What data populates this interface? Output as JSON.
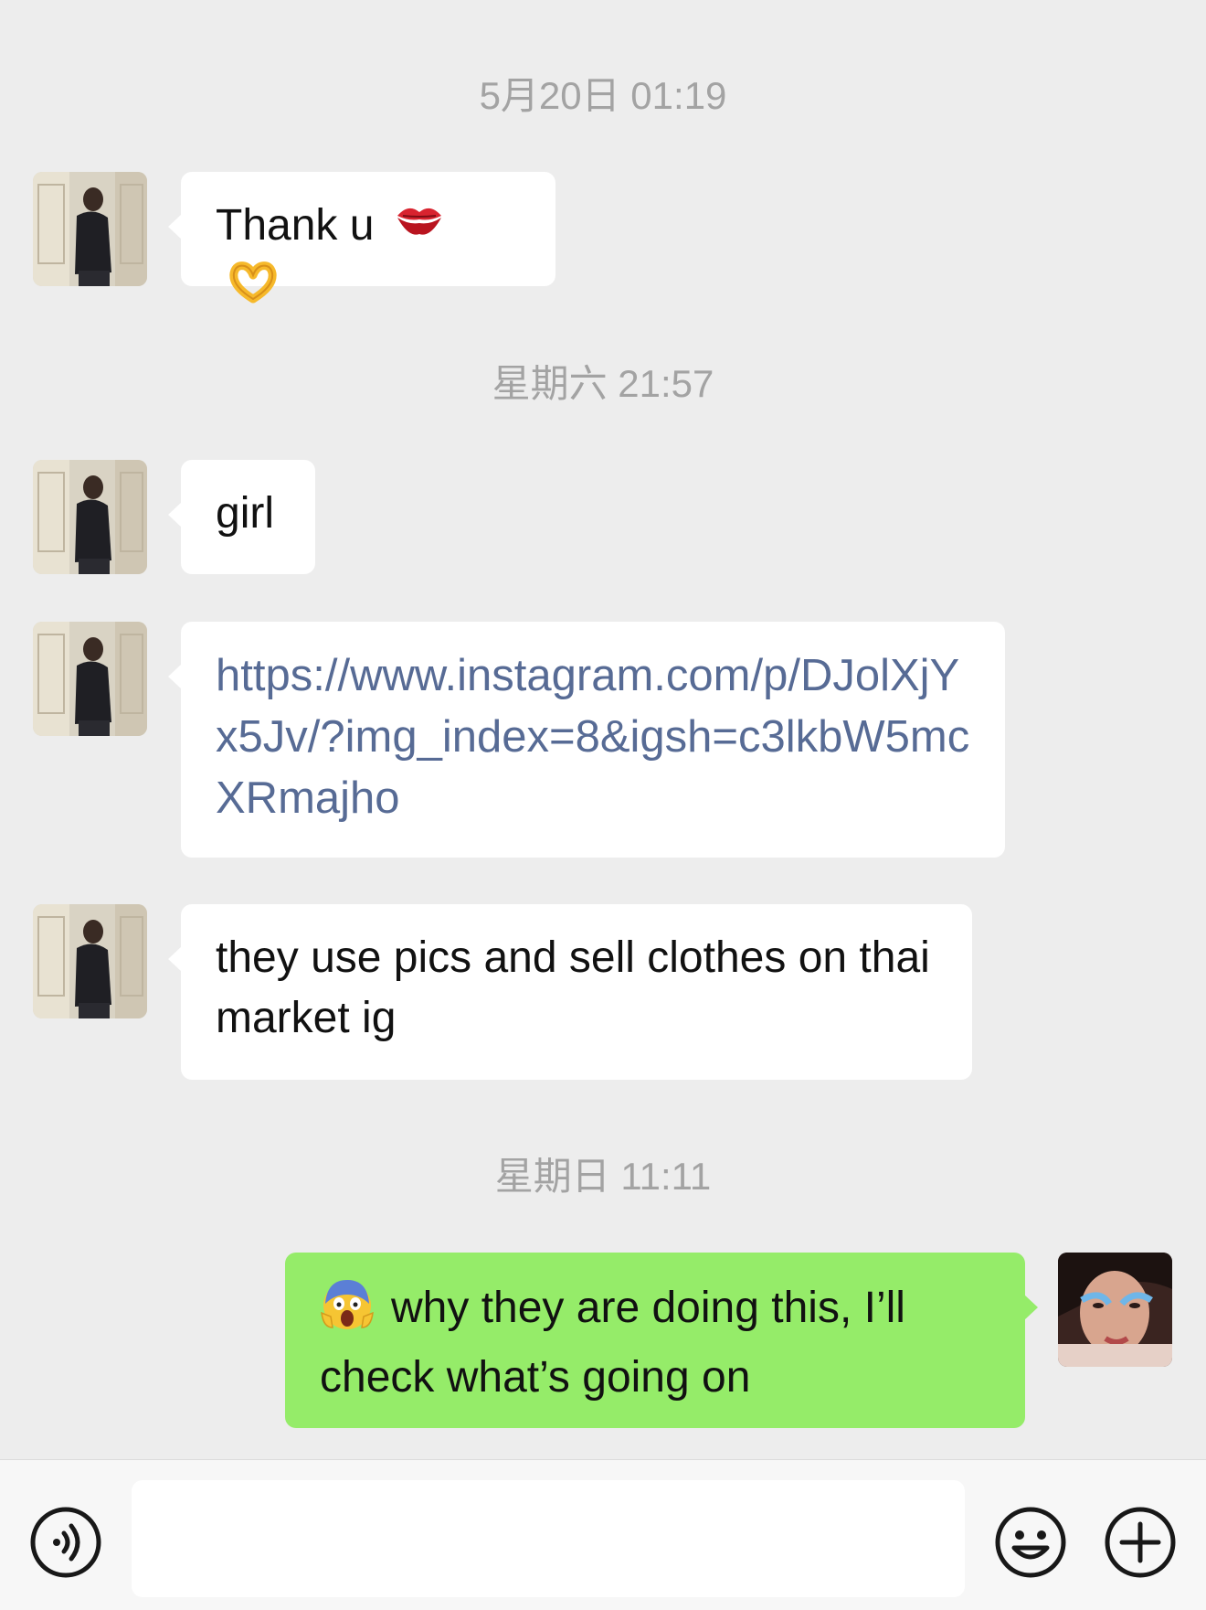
{
  "chat": {
    "timestamps": [
      "5月20日 01:19",
      "星期六 21:57",
      "星期日 11:11"
    ],
    "messages": [
      {
        "text": "Thank u",
        "emojis": [
          "lips-emoji",
          "heart-hands-emoji"
        ]
      },
      {
        "text": "girl"
      },
      {
        "text": "https://www.instagram.com/p/DJolXjYx5Jv/?img_index=8&igsh=c3lkbW5mcXRmajho"
      },
      {
        "text": "they use pics and sell clothes on thai market ig"
      },
      {
        "text": "why they are doing this, I’ll check what’s going on",
        "emojis": [
          "screaming-face-emoji"
        ]
      }
    ]
  },
  "input_bar": {
    "message_value": "",
    "icons": [
      "voice-input-icon",
      "emoji-icon",
      "plus-icon"
    ]
  },
  "colors": {
    "background": "#ededed",
    "incoming_bubble": "#ffffff",
    "outgoing_bubble": "#95ec69",
    "link": "#576b95",
    "timestamp": "#a3a3a3"
  }
}
